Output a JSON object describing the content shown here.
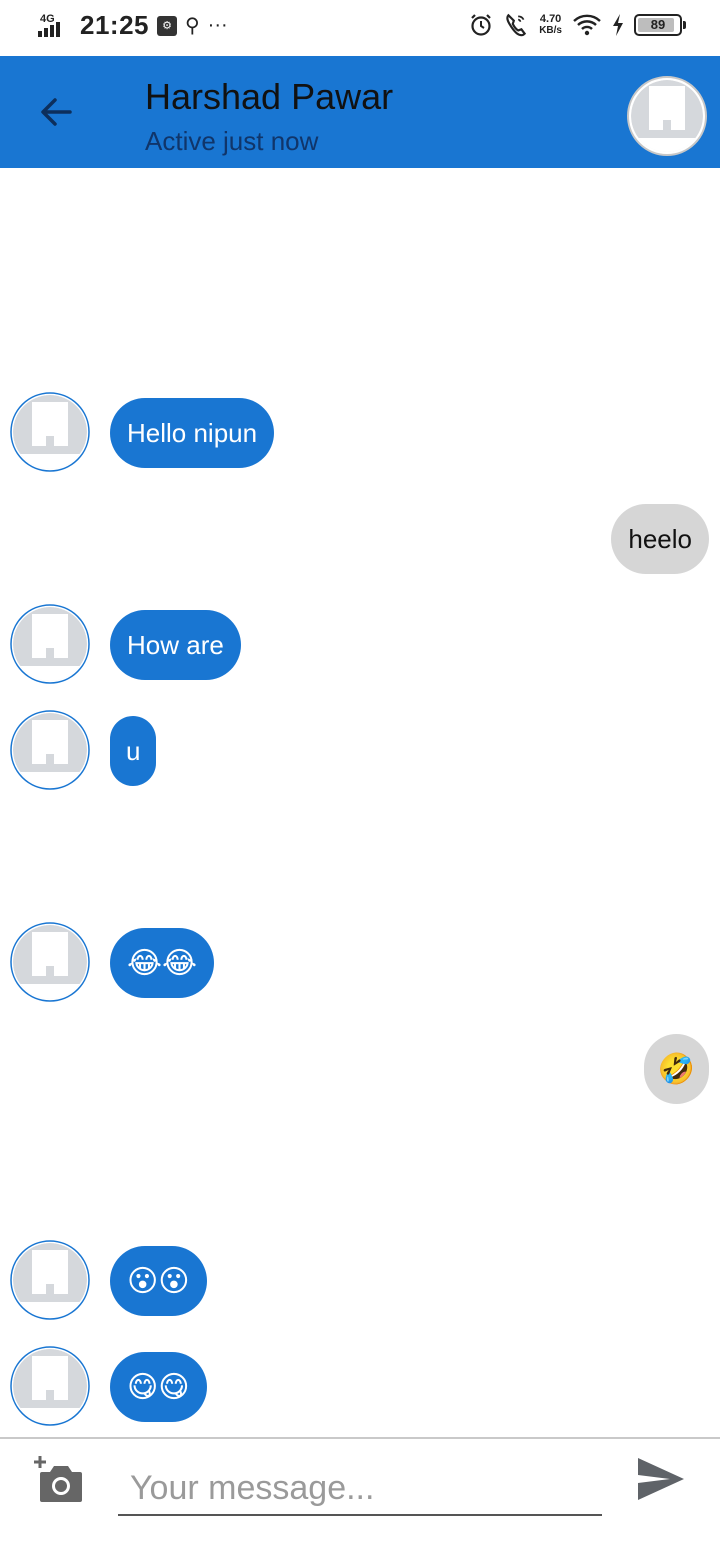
{
  "status_bar": {
    "network": "4G",
    "time": "21:25",
    "speed_value": "4.70",
    "speed_unit": "KB/s",
    "battery_percent": "89"
  },
  "header": {
    "title": "Harshad Pawar",
    "subtitle": "Active just now"
  },
  "messages": [
    {
      "side": "in",
      "text": "Hello nipun"
    },
    {
      "side": "out",
      "text": "heelo"
    },
    {
      "side": "in",
      "text": "How are"
    },
    {
      "side": "in",
      "text": "u"
    },
    {
      "side": "in",
      "text": "😂😂"
    },
    {
      "side": "out",
      "text": "🤣"
    },
    {
      "side": "in",
      "text": "😮😮"
    },
    {
      "side": "in",
      "text": "😋😋"
    }
  ],
  "composer": {
    "placeholder": "Your message..."
  },
  "colors": {
    "primary": "#1976d2",
    "incoming_bubble": "#1976d2",
    "outgoing_bubble": "#d6d6d6",
    "avatar_placeholder": "#d5d8dc"
  }
}
